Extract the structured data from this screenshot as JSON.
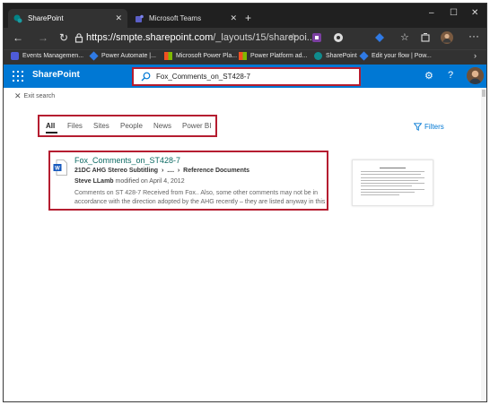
{
  "browser": {
    "tabs": [
      {
        "label": "SharePoint",
        "active": true
      },
      {
        "label": "Microsoft Teams",
        "active": false
      }
    ],
    "new_tab_symbol": "+",
    "window_controls": [
      "–",
      "☐",
      "✕"
    ],
    "url_host": "https://smpte.sharepoint.com",
    "url_path": "/_layouts/15/sharepoi...",
    "bookmarks": [
      {
        "label": "Events Managemen...",
        "icon": "events-icon",
        "color": "#4e5bd8"
      },
      {
        "label": "Power Automate |...",
        "icon": "power-automate-icon",
        "color": "#2f7ae5"
      },
      {
        "label": "Microsoft Power Pla...",
        "icon": "microsoft-icon",
        "color": "#f2c811"
      },
      {
        "label": "Power Platform ad...",
        "icon": "microsoft-icon",
        "color": "#f2c811"
      },
      {
        "label": "SharePoint",
        "icon": "sharepoint-icon",
        "color": "#0f8b8d"
      },
      {
        "label": "Edit your flow | Pow...",
        "icon": "power-automate-icon",
        "color": "#2f7ae5"
      }
    ]
  },
  "sharepoint": {
    "app_name": "SharePoint",
    "search_value": "Fox_Comments_on_ST428-7",
    "settings_icon": "gear-icon",
    "help_label": "?"
  },
  "search": {
    "exit_label": "Exit search",
    "pivots": [
      "All",
      "Files",
      "Sites",
      "People",
      "News",
      "Power BI"
    ],
    "filters_label": "Filters"
  },
  "result": {
    "title": "Fox_Comments_on_ST428-7",
    "path_site": "21DC AHG Stereo Subtitling",
    "path_ellipsis": "....",
    "path_folder": "Reference Documents",
    "author": "Steve LLamb",
    "modified": "modified on April 4, 2012",
    "snippet": "Comments on ST 428-7 Received from Fox.. Also, some other comments may not be in accordance with the direction adopted by the AHG recently – they are listed anyway in this"
  },
  "colors": {
    "brand": "#0078d4",
    "highlight_box": "#b51d30",
    "result_title": "#0e6b64"
  }
}
